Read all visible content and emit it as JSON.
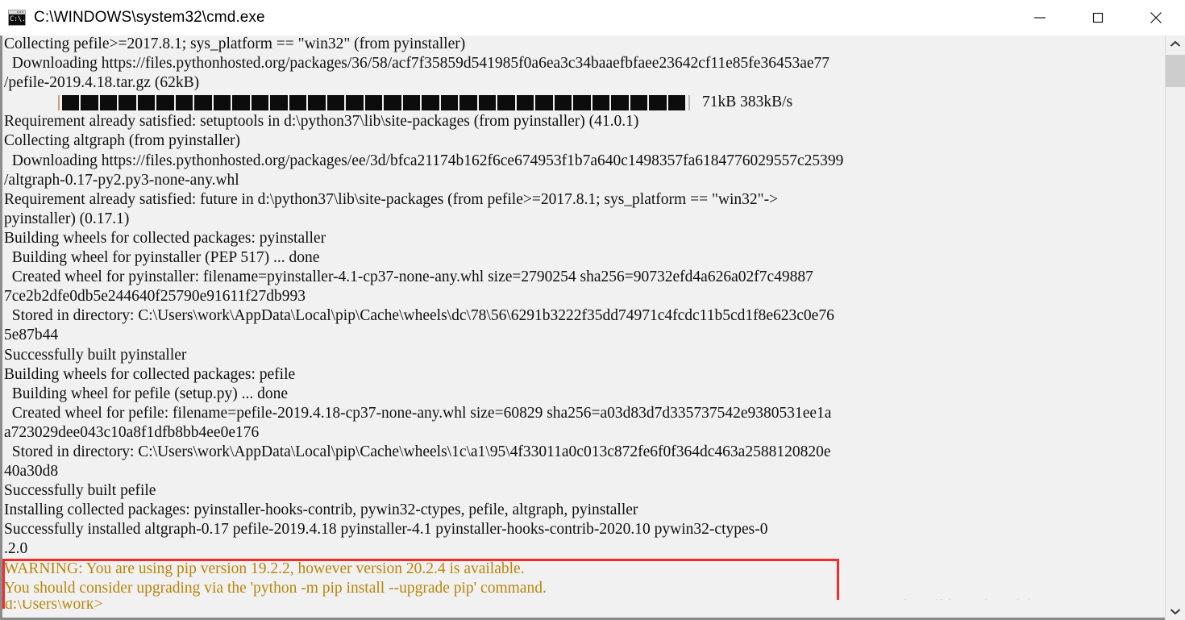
{
  "window": {
    "title": "C:\\WINDOWS\\system32\\cmd.exe",
    "icon_text": "C:\\.",
    "controls": {
      "minimize_label": "Minimize",
      "maximize_label": "Maximize",
      "close_label": "Close"
    }
  },
  "colors": {
    "background": "#f1f1f1",
    "text": "#101010",
    "warning_text": "#b8860b",
    "annotation_box": "#fb2828",
    "titlebar": "#ffffff",
    "block": "#0c0c0c",
    "scrollbar_thumb": "#cdcdcd",
    "watermark": "#d9d9d9"
  },
  "console": {
    "lines": [
      {
        "id": "l01",
        "text": "Collecting pefile>=2017.8.1; sys_platform == \"win32\" (from pyinstaller)",
        "style": "normal"
      },
      {
        "id": "l02",
        "text": "  Downloading https://files.pythonhosted.org/packages/36/58/acf7f35859d541985f0a6ea3c34baaefbfaee23642cf11e85fe36453ae77",
        "style": "normal"
      },
      {
        "id": "l03",
        "text": "/pefile-2019.4.18.tar.gz (62kB)",
        "style": "normal"
      },
      {
        "id": "l04",
        "text": "",
        "style": "progress"
      },
      {
        "id": "l05",
        "text": "Requirement already satisfied: setuptools in d:\\python37\\lib\\site-packages (from pyinstaller) (41.0.1)",
        "style": "normal"
      },
      {
        "id": "l06",
        "text": "Collecting altgraph (from pyinstaller)",
        "style": "normal"
      },
      {
        "id": "l07",
        "text": "  Downloading https://files.pythonhosted.org/packages/ee/3d/bfca21174b162f6ce674953f1b7a640c1498357fa6184776029557c25399",
        "style": "normal"
      },
      {
        "id": "l08",
        "text": "/altgraph-0.17-py2.py3-none-any.whl",
        "style": "normal"
      },
      {
        "id": "l09",
        "text": "Requirement already satisfied: future in d:\\python37\\lib\\site-packages (from pefile>=2017.8.1; sys_platform == \"win32\"->",
        "style": "normal"
      },
      {
        "id": "l10",
        "text": "pyinstaller) (0.17.1)",
        "style": "normal"
      },
      {
        "id": "l11",
        "text": "Building wheels for collected packages: pyinstaller",
        "style": "normal"
      },
      {
        "id": "l12",
        "text": "  Building wheel for pyinstaller (PEP 517) ... done",
        "style": "normal"
      },
      {
        "id": "l13",
        "text": "  Created wheel for pyinstaller: filename=pyinstaller-4.1-cp37-none-any.whl size=2790254 sha256=90732efd4a626a02f7c49887",
        "style": "normal"
      },
      {
        "id": "l14",
        "text": "7ce2b2dfe0db5e244640f25790e91611f27db993",
        "style": "normal"
      },
      {
        "id": "l15",
        "text": "  Stored in directory: C:\\Users\\work\\AppData\\Local\\pip\\Cache\\wheels\\dc\\78\\56\\6291b3222f35dd74971c4fcdc11b5cd1f8e623c0e76",
        "style": "normal"
      },
      {
        "id": "l16",
        "text": "5e87b44",
        "style": "normal"
      },
      {
        "id": "l17",
        "text": "Successfully built pyinstaller",
        "style": "normal"
      },
      {
        "id": "l18",
        "text": "Building wheels for collected packages: pefile",
        "style": "normal"
      },
      {
        "id": "l19",
        "text": "  Building wheel for pefile (setup.py) ... done",
        "style": "normal"
      },
      {
        "id": "l20",
        "text": "  Created wheel for pefile: filename=pefile-2019.4.18-cp37-none-any.whl size=60829 sha256=a03d83d7d335737542e9380531ee1a",
        "style": "normal"
      },
      {
        "id": "l21",
        "text": "a723029dee043c10a8f1dfb8bb4ee0e176",
        "style": "normal"
      },
      {
        "id": "l22",
        "text": "  Stored in directory: C:\\Users\\work\\AppData\\Local\\pip\\Cache\\wheels\\1c\\a1\\95\\4f33011a0c013c872fe6f0f364dc463a2588120820e",
        "style": "normal"
      },
      {
        "id": "l23",
        "text": "40a30d8",
        "style": "normal"
      },
      {
        "id": "l24",
        "text": "Successfully built pefile",
        "style": "normal"
      },
      {
        "id": "l25",
        "text": "Installing collected packages: pyinstaller-hooks-contrib, pywin32-ctypes, pefile, altgraph, pyinstaller",
        "style": "normal"
      },
      {
        "id": "l26",
        "text": "Successfully installed altgraph-0.17 pefile-2019.4.18 pyinstaller-4.1 pyinstaller-hooks-contrib-2020.10 pywin32-ctypes-0",
        "style": "normal"
      },
      {
        "id": "l27",
        "text": ".2.0",
        "style": "normal"
      },
      {
        "id": "l28",
        "text": "WARNING: You are using pip version 19.2.2, however version 20.2.4 is available.",
        "style": "warn"
      },
      {
        "id": "l29",
        "text": "You should consider upgrading via the 'python -m pip install --upgrade pip' command.",
        "style": "warn"
      }
    ],
    "progress": {
      "block_count": 33,
      "separator": "|",
      "downloaded": "71kB",
      "rate": "383kB/s",
      "rate_text": "|  71kB 383kB/s"
    },
    "partial_bottom_line": "d:\\Users\\work>"
  },
  "annotation": {
    "box_label": "red-highlight-around-pip-warning"
  },
  "watermark": {
    "text": "https://blog.csdn.net/Charonmomo"
  },
  "scrollbar": {
    "up_label": "Scroll up",
    "down_label": "Scroll down",
    "thumb_label": "Scroll thumb"
  }
}
